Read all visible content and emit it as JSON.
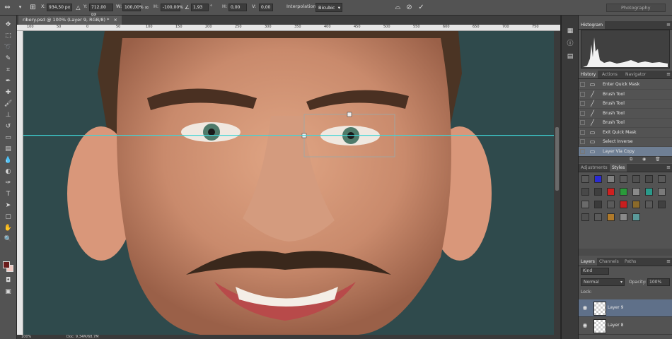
{
  "options_bar": {
    "x_label": "X:",
    "x_value": "934,50 px",
    "y_label": "Y:",
    "y_value": "712,00 px",
    "w_label": "W:",
    "w_value": "100,00%",
    "h_label": "H:",
    "h_value": "-100,00%",
    "angle_value": "1,93",
    "hskew_label": "H:",
    "hskew_value": "0,00",
    "vskew_label": "V:",
    "vskew_value": "0,00",
    "interpolation_label": "Interpolation:",
    "interpolation_value": "Bicubic",
    "workspace": "Photography"
  },
  "document": {
    "tab_title": "ribery.psd @ 100% (Layer 9, RGB/8) *",
    "ruler_ticks": [
      "100",
      "50",
      "0",
      "50",
      "100",
      "150",
      "200",
      "250",
      "300",
      "350",
      "400",
      "450",
      "500",
      "550",
      "600",
      "650",
      "700",
      "750"
    ],
    "status_zoom": "100%",
    "status_doc": "Doc: 9,34M/68,7M"
  },
  "histogram": {
    "tab": "Histogram"
  },
  "history": {
    "tabs": [
      "History",
      "Actions",
      "Navigator"
    ],
    "items": [
      {
        "label": "Enter Quick Mask",
        "icon": "history-state-icon"
      },
      {
        "label": "Brush Tool",
        "icon": "brush-icon"
      },
      {
        "label": "Brush Tool",
        "icon": "brush-icon"
      },
      {
        "label": "Brush Tool",
        "icon": "brush-icon"
      },
      {
        "label": "Brush Tool",
        "icon": "brush-icon"
      },
      {
        "label": "Exit Quick Mask",
        "icon": "history-state-icon"
      },
      {
        "label": "Select Inverse",
        "icon": "history-state-icon"
      },
      {
        "label": "Layer Via Copy",
        "icon": "history-state-icon"
      }
    ],
    "selected_index": 7
  },
  "styles": {
    "tabs": [
      "Adjustments",
      "Styles"
    ],
    "swatches": [
      "#5a5a5a",
      "#2b2bd0",
      "#808080",
      "#5a5a5a",
      "#505050",
      "#4a4a4a",
      "#5a5a5a",
      "#484848",
      "#3e3e3e",
      "#d02020",
      "#2a9a3a",
      "#8a8a8a",
      "#2a9a8a",
      "#7a7a7a",
      "#6a6a6a",
      "#3a3a3a",
      "#5a5a5a",
      "#c81e1e",
      "#8a6a2a",
      "#5a5a5a",
      "#404040",
      "#505050",
      "#5a5a5a",
      "#b07a2a",
      "#8a8a8a",
      "#5a9a9a"
    ]
  },
  "layers": {
    "tabs": [
      "Layers",
      "Channels",
      "Paths"
    ],
    "kind": "Kind",
    "blend_mode": "Normal",
    "opacity_label": "Opacity:",
    "opacity_value": "100%",
    "lock_label": "Lock:",
    "items": [
      {
        "name": "Layer 9",
        "selected": true
      },
      {
        "name": "Layer 8",
        "selected": false
      }
    ]
  },
  "colors": {
    "foreground": "#6a1c1c",
    "background": "#f0c8c0",
    "guide": "#3fd4d6",
    "canvas_bg": "#2f4a4c"
  }
}
